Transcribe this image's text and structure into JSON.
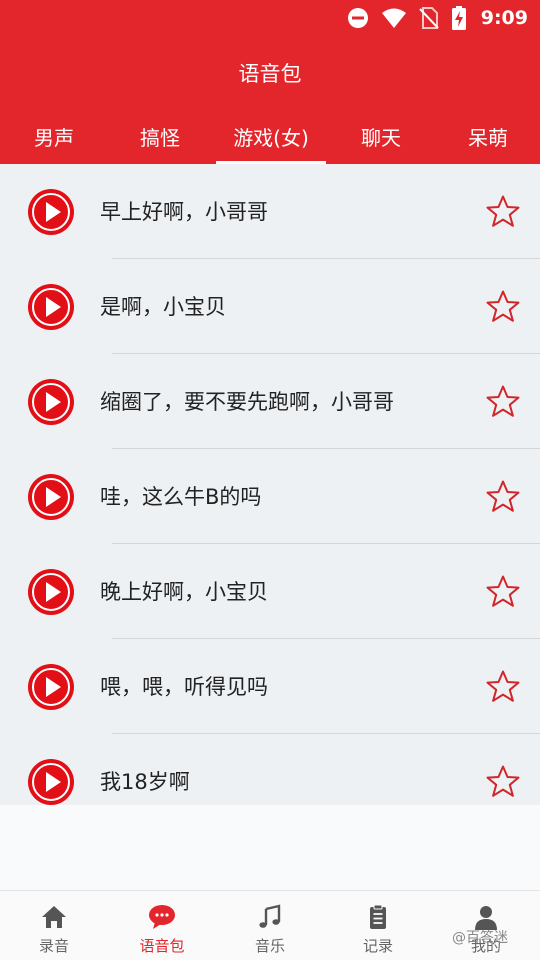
{
  "status_bar": {
    "time": "9:09"
  },
  "header": {
    "title": "语音包"
  },
  "tabs": [
    {
      "label": "男声"
    },
    {
      "label": "搞怪"
    },
    {
      "label": "游戏(女)",
      "active": true
    },
    {
      "label": "聊天"
    },
    {
      "label": "呆萌"
    }
  ],
  "items": [
    {
      "text": "早上好啊，小哥哥"
    },
    {
      "text": "是啊，小宝贝"
    },
    {
      "text": "缩圈了，要不要先跑啊，小哥哥"
    },
    {
      "text": "哇，这么牛B的吗"
    },
    {
      "text": "晚上好啊，小宝贝"
    },
    {
      "text": "喂，喂，听得见吗"
    },
    {
      "text": "我18岁啊"
    }
  ],
  "bottom_nav": [
    {
      "label": "录音",
      "icon": "home-icon"
    },
    {
      "label": "语音包",
      "icon": "chat-bubble-icon",
      "active": true
    },
    {
      "label": "音乐",
      "icon": "music-note-icon"
    },
    {
      "label": "记录",
      "icon": "clipboard-icon"
    },
    {
      "label": "我的",
      "icon": "person-icon"
    }
  ],
  "watermark": "@百答迷",
  "colors": {
    "primary": "#e3262b",
    "play_button": "#e20f16",
    "star_outline": "#d1262b",
    "list_background": "#eef1f4"
  }
}
